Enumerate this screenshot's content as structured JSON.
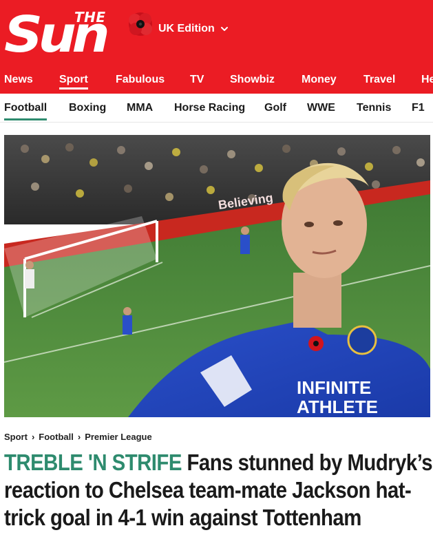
{
  "brand": {
    "logo_small": "THE",
    "logo_main": "Sun",
    "edition_label": "UK Edition",
    "color_primary": "#eb1c24",
    "color_kicker": "#2e8b6e"
  },
  "nav_main": {
    "items": [
      {
        "label": "News"
      },
      {
        "label": "Sport"
      },
      {
        "label": "Fabulous"
      },
      {
        "label": "TV"
      },
      {
        "label": "Showbiz"
      },
      {
        "label": "Money"
      },
      {
        "label": "Travel"
      },
      {
        "label": "He"
      }
    ],
    "active": "Sport"
  },
  "nav_sub": {
    "items": [
      {
        "label": "Football"
      },
      {
        "label": "Boxing"
      },
      {
        "label": "MMA"
      },
      {
        "label": "Horse Racing"
      },
      {
        "label": "Golf"
      },
      {
        "label": "WWE"
      },
      {
        "label": "Tennis"
      },
      {
        "label": "F1"
      }
    ],
    "active": "Football"
  },
  "hero": {
    "board_text": "Believing",
    "shirt_sponsor_line1": "INFINITE",
    "shirt_sponsor_line2": "ATHLETE",
    "icon": "photo"
  },
  "breadcrumb": {
    "items": [
      "Sport",
      "Football",
      "Premier League"
    ],
    "separator_icon": "chevron-right-icon"
  },
  "article": {
    "kicker": "TREBLE 'N STRIFE",
    "headline": "Fans stunned by Mudryk’s reaction to Chelsea team-mate Jackson hat-trick goal in 4-1 win against Tottenham"
  }
}
